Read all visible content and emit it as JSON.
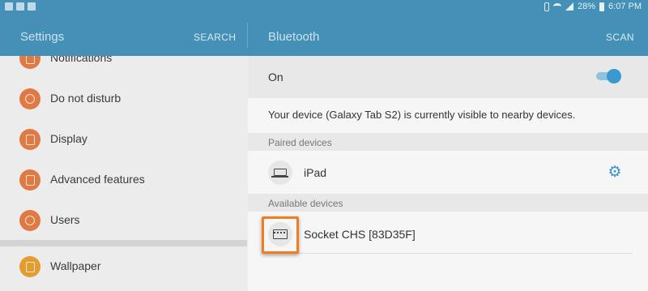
{
  "status_bar": {
    "battery": "28%",
    "time": "6:07 PM"
  },
  "left_header": {
    "title": "Settings",
    "search": "SEARCH"
  },
  "right_header": {
    "title": "Bluetooth",
    "scan": "SCAN"
  },
  "settings_menu": {
    "items": [
      {
        "label": "Notifications",
        "icon": "notifications-icon"
      },
      {
        "label": "Do not disturb",
        "icon": "do-not-disturb-icon"
      },
      {
        "label": "Display",
        "icon": "display-icon"
      },
      {
        "label": "Advanced features",
        "icon": "advanced-features-icon"
      },
      {
        "label": "Users",
        "icon": "users-icon"
      },
      {
        "label": "Wallpaper",
        "icon": "wallpaper-icon"
      }
    ]
  },
  "bluetooth": {
    "toggle_label": "On",
    "toggle_on": true,
    "visibility_message": "Your device (Galaxy Tab S2) is currently visible to nearby devices.",
    "paired_header": "Paired devices",
    "paired": [
      {
        "name": "iPad",
        "icon": "laptop-icon"
      }
    ],
    "available_header": "Available devices",
    "available": [
      {
        "name": "Socket CHS [83D35F]",
        "icon": "keyboard-icon"
      }
    ]
  },
  "colors": {
    "accent": "#4490b6",
    "icon_orange": "#e07a45",
    "highlight": "#f07d1e",
    "toggle": "#3a9ad0"
  }
}
